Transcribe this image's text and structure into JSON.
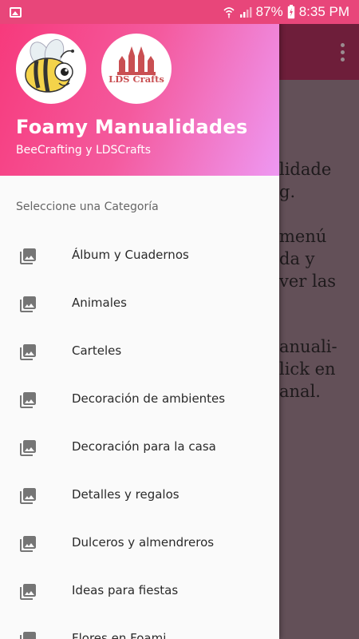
{
  "status_bar": {
    "battery": "87%",
    "time": "8:35 PM"
  },
  "background": {
    "lines": [
      "lidade",
      "g.",
      "menú",
      "da y",
      "ver las",
      "anuali-",
      "lick en",
      "anal."
    ]
  },
  "drawer": {
    "logos": [
      "bee-logo",
      "LDS Crafts"
    ],
    "lds_logo_text": "LDS Crafts",
    "title": "Foamy Manualidades",
    "subtitle": "BeeCrafting y LDSCrafts",
    "section_label": "Seleccione una Categoría",
    "items": [
      {
        "label": "Álbum y Cuadernos",
        "icon": "image-icon"
      },
      {
        "label": "Animales",
        "icon": "image-icon"
      },
      {
        "label": "Carteles",
        "icon": "image-icon"
      },
      {
        "label": "Decoración de ambientes",
        "icon": "image-icon"
      },
      {
        "label": "Decoración para la casa",
        "icon": "image-icon"
      },
      {
        "label": "Detalles y regalos",
        "icon": "image-icon"
      },
      {
        "label": "Dulceros y almendreros",
        "icon": "image-icon"
      },
      {
        "label": "Ideas para fiestas",
        "icon": "image-icon"
      },
      {
        "label": "Flores en Foami",
        "icon": "image-icon"
      }
    ]
  },
  "colors": {
    "status_bar": "#e8467a",
    "header_start": "#f7387a",
    "header_end": "#ee98f2",
    "toolbar_bg": "#6e1e3a",
    "scrim": "#635058"
  }
}
